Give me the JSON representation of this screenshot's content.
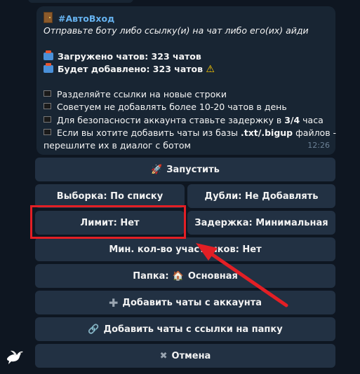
{
  "message": {
    "title": "#АвтоВход",
    "subtitle": "Отправьте боту либо ссылку(и) на чат либо его(их) айди",
    "loaded": "Загружено чатов: 323 чатов",
    "will_add": "Будет добавлено: 323 чатов",
    "tip1": "Разделяйте ссылки на новые строки",
    "tip2": "Советуем не добавлять более 10-20 чатов в день",
    "tip3_prefix": "Для безопасности аккаунта ставьте задержку в ",
    "tip3_bold": "3/4",
    "tip3_suffix": " часа",
    "tip4_prefix": "Если вы хотите добавить чаты из базы ",
    "tip4_bold": ".txt/.bigup",
    "tip4_suffix": " файлов -",
    "tip4_line2": "перешлите их в диалог с ботом",
    "time": "12:26"
  },
  "buttons": {
    "launch": "Запустить",
    "selection": "Выборка: По списку",
    "duplicates": "Дубли: Не Добавлять",
    "limit": "Лимит: Нет",
    "delay": "Задержка: Минимальная",
    "min_members": "Мин. кол-во участников: Нет",
    "folder_prefix": "Папка:",
    "folder_name": "Основная",
    "add_from_account": "Добавить чаты с аккаунта",
    "add_from_folder_link": "Добавить чаты с ссылки на папку",
    "cancel": "Отмена"
  },
  "icons": {
    "header": "door-icon",
    "loaded": "inbox-tray-icon",
    "will_add": "inbox-tray-icon",
    "warning": "warning-icon",
    "bullets": "black-square-icon",
    "launch": "rocket-icon",
    "folder": "house-icon",
    "add_account": "plus-icon",
    "add_link": "link-icon",
    "cancel": "x-icon",
    "bot_avatar": "dove-icon"
  },
  "colors": {
    "background": "#0e1621",
    "bubble": "#182533",
    "button": "#223143",
    "accent_title": "#66b3f0",
    "annotation_red": "#e31f25"
  }
}
